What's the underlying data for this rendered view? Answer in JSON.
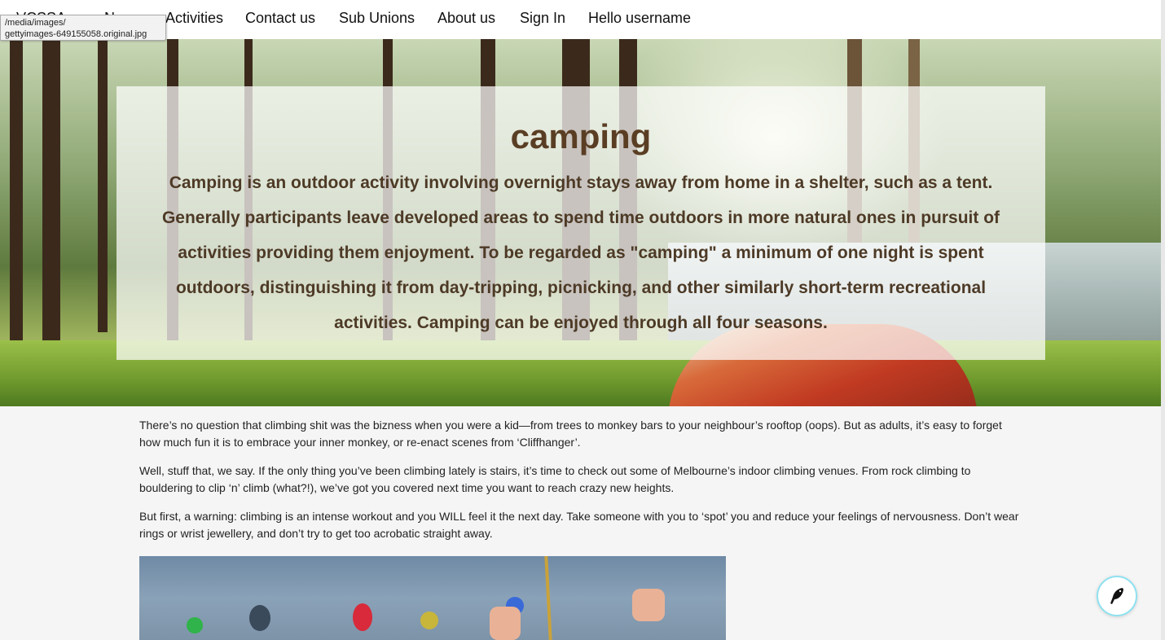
{
  "nav": {
    "brand": "VCSSA",
    "items": [
      "News",
      "Activities",
      "Contact us",
      "Sub Unions",
      "About us",
      "Sign In",
      "Hello username"
    ]
  },
  "tooltip": {
    "line1": "/media/images/",
    "line2": "gettyimages-649155058.original.jpg"
  },
  "hero": {
    "title": "camping",
    "text": "Camping is an outdoor activity involving overnight stays away from home in a shelter, such as a tent. Generally participants leave developed areas to spend time outdoors in more natural ones in pursuit of activities providing them enjoyment. To be regarded as \"camping\" a minimum of one night is spent outdoors, distinguishing it from day-tripping, picnicking, and other similarly short-term recreational activities. Camping can be enjoyed through all four seasons."
  },
  "content": {
    "paragraphs": [
      "There’s no question that climbing shit was the bizness when you were a kid—from trees to monkey bars to your neighbour’s rooftop (oops). But as adults, it’s easy to forget how much fun it is to embrace your inner monkey, or re-enact scenes from ‘Cliffhanger’.",
      "Well, stuff that, we say. If the only thing you’ve been climbing lately is stairs, it’s time to check out some of Melbourne’s indoor climbing venues. From rock climbing to bouldering to clip ‘n’ climb (what?!), we’ve got you covered next time you want to reach crazy new heights.",
      "But first, a warning: climbing is an intense workout and you WILL feel it the next day. Take someone with you to ‘spot’ you and reduce your feelings of nervousness. Don’t wear rings or wrist jewellery, and don’t try to get too acrobatic straight away."
    ]
  },
  "icons": {
    "chat": "bird-quill-icon"
  },
  "colors": {
    "hero_text": "#4d3a26",
    "chat_border": "#8fe1f0"
  }
}
